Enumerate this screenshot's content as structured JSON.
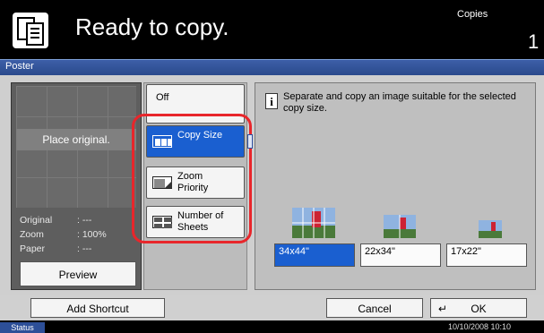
{
  "header": {
    "title": "Ready to copy.",
    "copies_label": "Copies",
    "copies_count": "1"
  },
  "strip": {
    "label": "Poster"
  },
  "preview": {
    "place_original": "Place original.",
    "info": [
      {
        "label": "Original",
        "value": ": ---"
      },
      {
        "label": "Zoom",
        "value": ": 100%"
      },
      {
        "label": "Paper",
        "value": ": ---"
      }
    ],
    "preview_button": "Preview"
  },
  "options": {
    "off": "Off",
    "copy_size": "Copy Size",
    "zoom_priority_l1": "Zoom",
    "zoom_priority_l2": "Priority",
    "number_of_sheets_l1": "Number of",
    "number_of_sheets_l2": "Sheets"
  },
  "description": "Separate and copy an image suitable for the selected copy size.",
  "sizes": [
    {
      "label": "34x44\"",
      "selected": true
    },
    {
      "label": "22x34\"",
      "selected": false
    },
    {
      "label": "17x22\"",
      "selected": false
    }
  ],
  "bottom": {
    "add_shortcut": "Add Shortcut",
    "cancel": "Cancel",
    "ok": "OK"
  },
  "status": {
    "label": "Status",
    "datetime": "10/10/2008   10:10"
  },
  "colors": {
    "accent": "#1a5fd0",
    "highlight": "#e8262b"
  }
}
